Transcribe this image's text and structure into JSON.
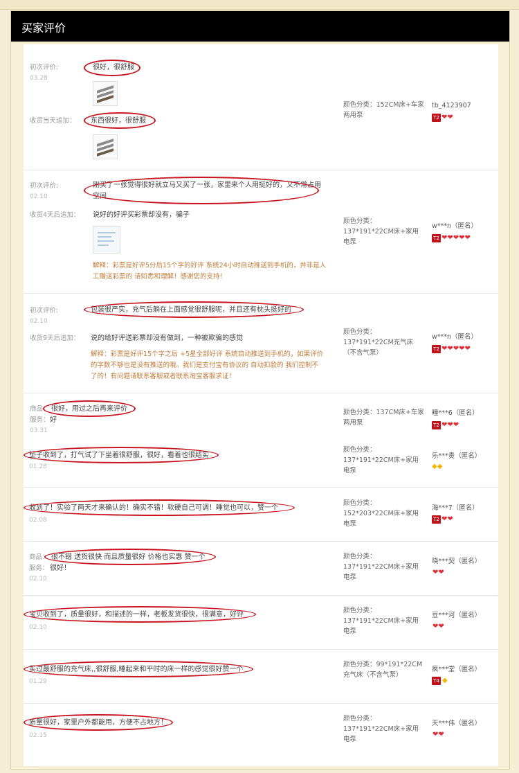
{
  "header": {
    "title": "买家评价"
  },
  "badge_colors": {
    "level": "#c0121b",
    "heart": "#e0303a",
    "diamond": "#f2b705",
    "highlight": "#c8141e"
  },
  "reviews": [
    {
      "first_label": "初次评价:",
      "first_date": "03.28",
      "first_text": "很好，很舒服",
      "add_label": "收货当天追加：",
      "add_text": "东西很好，很舒服",
      "sku": "颜色分类：152CM床+车家两用泵",
      "user": "tb_4123907",
      "level": "T2",
      "hearts": "❤❤"
    },
    {
      "first_label": "初次评价:",
      "first_date": "02.10",
      "first_text": "刚买了一张觉得很好就立马又买了一张，家里来个人用挺好的，又不常占用空间",
      "add_label": "收货4天后追加：",
      "add_text": "说好的好评买彩票却没有，骗子",
      "explain": "解释：彩票是好评5分后15个字的好评 系统24小时自动推送到手机的，并非是人工赠送彩票的 请知悉和理解！感谢您的支持！",
      "sku": "颜色分类：137*191*22CM床+家用电泵",
      "user": "w***n（匿名）",
      "level": "T2",
      "hearts": "❤❤❤❤❤"
    },
    {
      "first_label": "初次评价:",
      "first_date": "02.10",
      "first_text": "包装很严实，充气后躺在上面感觉很舒服呢，并且还有枕头挺好的",
      "add_label": "收货9天后追加：",
      "add_text": "说的给好评送彩票却没有做到，一种被欺骗的感觉",
      "explain": "解释：彩票是好评15个字之后 +5星全部好评 系统自动推送到手机的，如果评价的字数不够也是没有推送的哦。我们是支付宝有协议的 自动扣款的 我们控制不了的！有问题请联系客服或者联系淘宝客服求证！",
      "sku": "颜色分类：137*191*22CM充气床（不含气泵）",
      "user": "w***n（匿名）",
      "level": "T2",
      "hearts": "❤❤❤❤❤"
    },
    {
      "first_label": "商品：",
      "first_text": "很好，用过之后再来评价",
      "service_label": "服务：",
      "service_value": "好",
      "first_date": "03.31",
      "sku": "颜色分类：137CM床+车家两用泵",
      "user": "瞳***6（匿名）",
      "level": "T2",
      "hearts": "❤❤❤"
    },
    {
      "first_text": "垫子收到了，打气试了下坐着很舒服，很好，看着也很结实",
      "first_date": "01.28",
      "sku": "颜色分类：137*191*22CM床+家用电泵",
      "user": "乐***贵（匿名）",
      "diamonds": "◆◆"
    },
    {
      "first_text": "收到了！实验了两天才来确认的！确实不错！软硬自己可调！睡觉也可以，赞一个",
      "first_date": "02.08",
      "sku": "颜色分类：152*203*22CM床+家用电泵",
      "user": "海***7（匿名）",
      "level": "T2",
      "hearts": "❤❤"
    },
    {
      "first_label": "商品：",
      "first_text": "很不错 送货很快 而且质量很好 价格也实惠 赞一个",
      "service_label": "服务：",
      "service_value": "很好！",
      "first_date": "02.10",
      "sku": "颜色分类：137*191*22CM床+家用电泵",
      "user": "晓***契（匿名）",
      "hearts": "❤❤"
    },
    {
      "first_text": "宝贝收到了，质量很好，和描述的一样，老板发货很快，很满意，好评",
      "first_date": "02.10",
      "sku": "颜色分类：137*191*22CM床+家用电泵",
      "user": "豆***河（匿名）",
      "hearts": "❤❤"
    },
    {
      "first_text": "买过最舒服的充气床,,很舒服,睡起来和平时的床一样的感觉很好赞一个",
      "first_date": "01.29",
      "sku": "颜色分类：99*191*22CM充气床（不含气泵）",
      "user": "疯***堂（匿名）",
      "level": "T4",
      "diamonds": "◆"
    },
    {
      "first_text": "质量很好，家里户外都能用，方便不占地方！",
      "first_date": "02.15",
      "sku": "颜色分类：137*191*22CM床+家用电泵",
      "user": "天***伟（匿名）",
      "hearts": "❤❤"
    }
  ]
}
